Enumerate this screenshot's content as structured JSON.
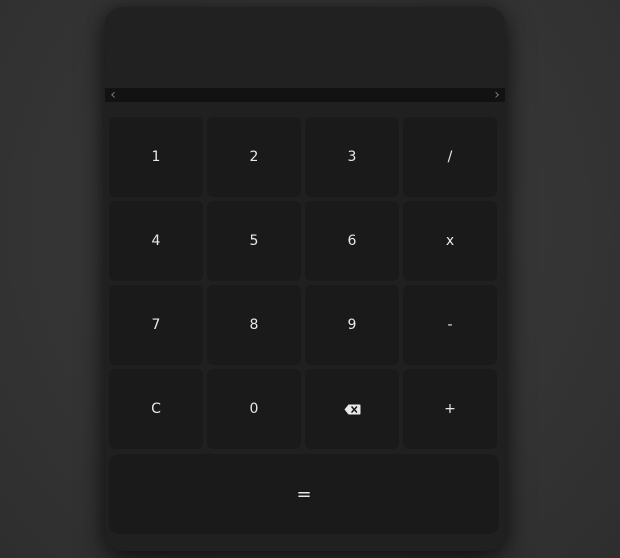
{
  "display": {
    "value": ""
  },
  "scrollbar": {
    "left_arrow": "‹",
    "right_arrow": "›"
  },
  "keys": {
    "k1": "1",
    "k2": "2",
    "k3": "3",
    "divide": "/",
    "k4": "4",
    "k5": "5",
    "k6": "6",
    "multiply": "x",
    "k7": "7",
    "k8": "8",
    "k9": "9",
    "subtract": "-",
    "clear": "C",
    "k0": "0",
    "backspace_icon": "backspace-icon",
    "add": "+",
    "equals": "="
  },
  "colors": {
    "background": "#363636",
    "calculator": "#212121",
    "key": "#1a1a1a",
    "text": "#e9e9e9",
    "scrollbar": "#121212"
  }
}
